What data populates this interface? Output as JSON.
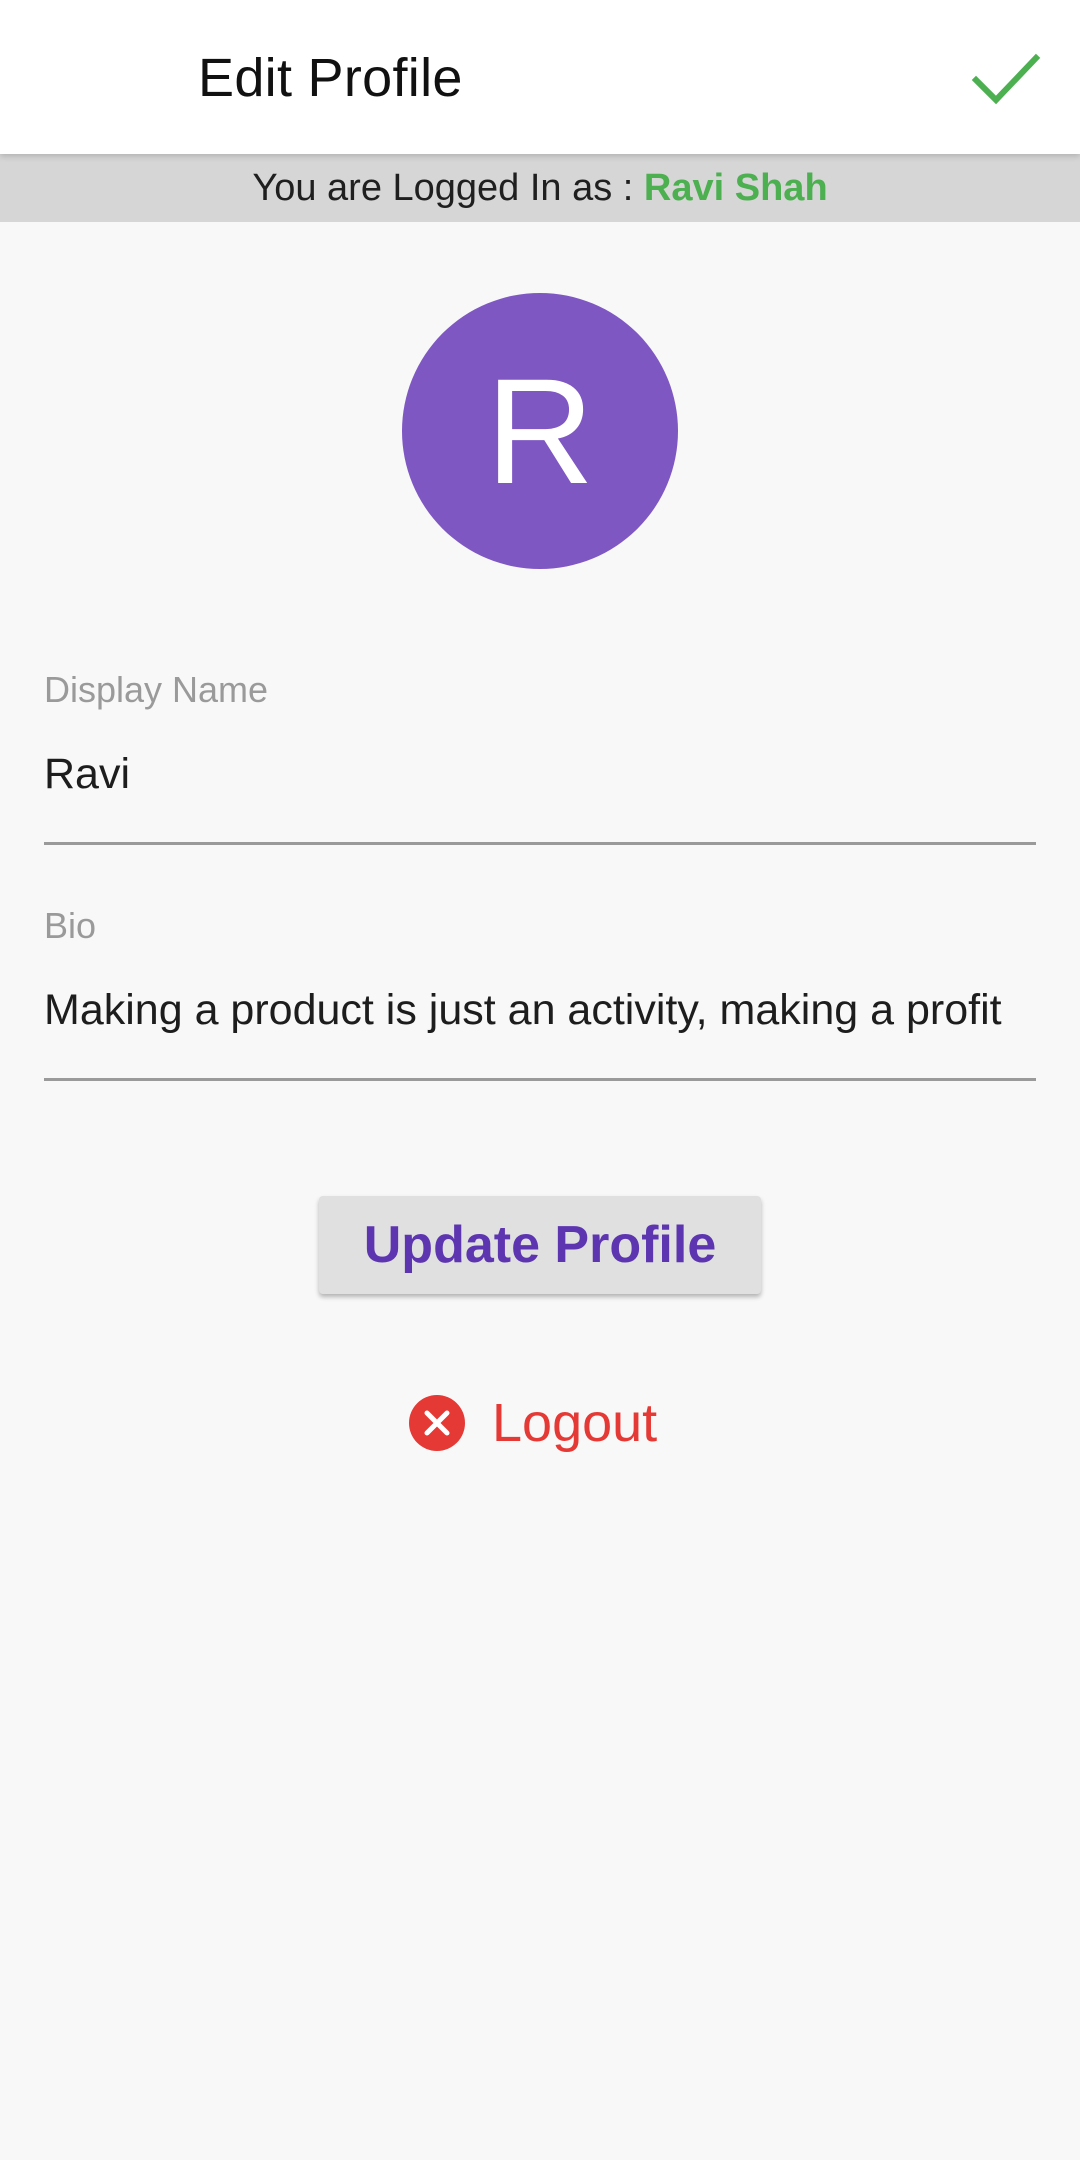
{
  "app_bar": {
    "title": "Edit Profile",
    "confirm_icon": "check-icon"
  },
  "login_banner": {
    "prefix": "You are Logged In as : ",
    "user_name": "Ravi Shah"
  },
  "avatar": {
    "initial": "R"
  },
  "form": {
    "display_name": {
      "label": "Display Name",
      "value": "Ravi"
    },
    "bio": {
      "label": "Bio",
      "value": "Making a product is just an activity, making a profit"
    }
  },
  "actions": {
    "update_label": "Update Profile",
    "logout_label": "Logout",
    "logout_icon": "cancel-circle-icon"
  },
  "colors": {
    "accent_green": "#4caf50",
    "avatar_purple": "#7e57c2",
    "button_text_purple": "#5e35b1",
    "logout_red": "#e53935"
  }
}
